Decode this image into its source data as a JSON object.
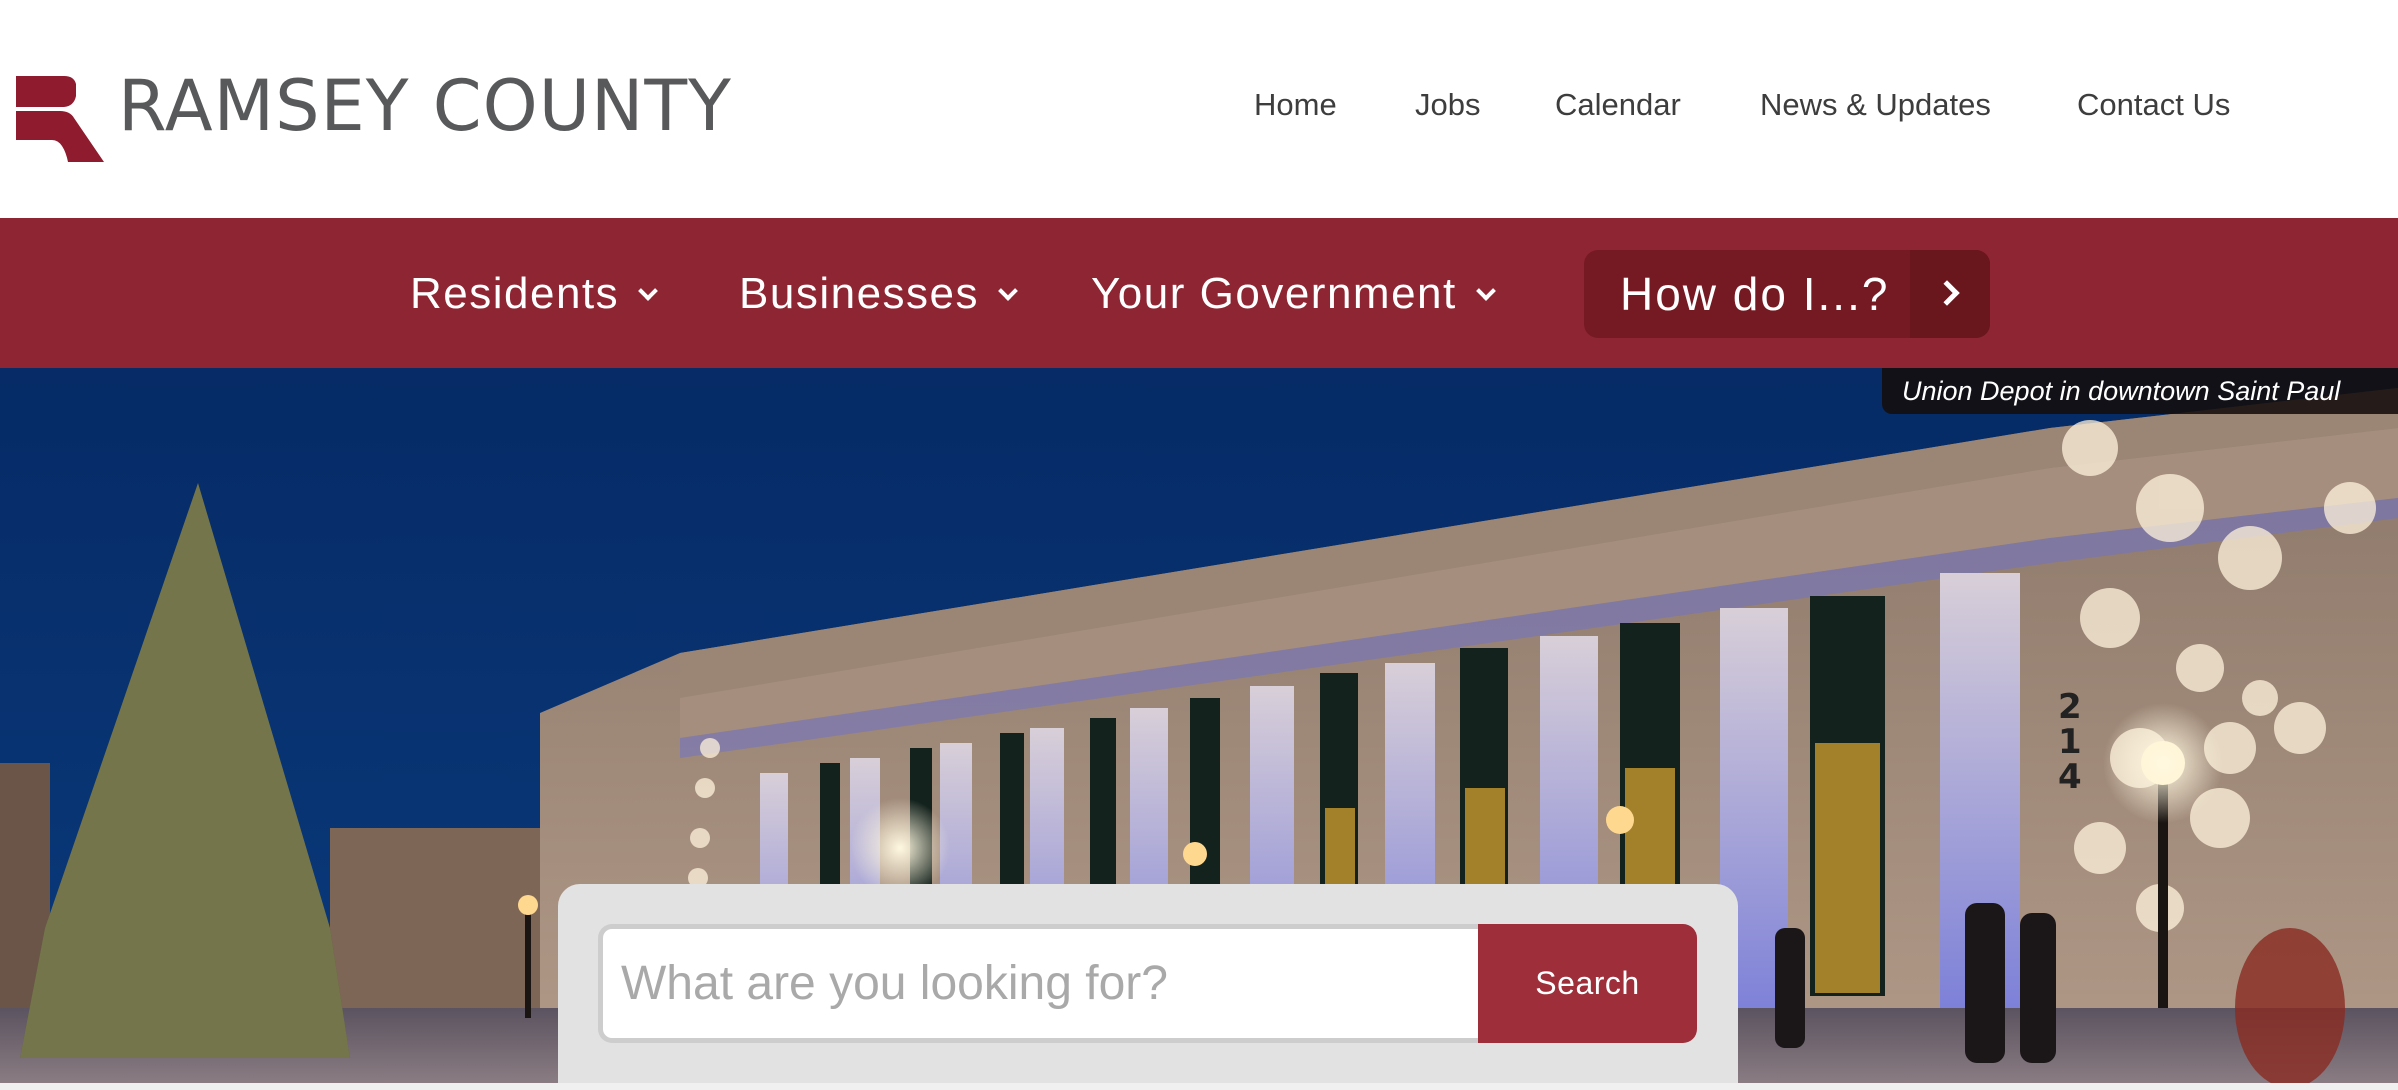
{
  "header": {
    "site_title": "RAMSEY COUNTY",
    "logo_icon": "ramsey-r-logo",
    "brand_color": "#8e2532",
    "utility_nav": [
      {
        "label": "Home"
      },
      {
        "label": "Jobs"
      },
      {
        "label": "Calendar"
      },
      {
        "label": "News & Updates"
      },
      {
        "label": "Contact Us"
      }
    ]
  },
  "main_nav": {
    "items": [
      {
        "label": "Residents",
        "icon": "chevron-down-icon"
      },
      {
        "label": "Businesses",
        "icon": "chevron-down-icon"
      },
      {
        "label": "Your Government",
        "icon": "chevron-down-icon"
      }
    ],
    "how_do_i": {
      "label": "How do I...?",
      "icon": "chevron-right-icon"
    }
  },
  "hero": {
    "image_description": "Union Depot building at night with lit Christmas tree and snowflake projections",
    "caption": "Union Depot in downtown Saint Paul",
    "building_number": "214"
  },
  "search": {
    "placeholder": "What are you looking for?",
    "value": "",
    "button_label": "Search",
    "button_color": "#9e2e3a"
  }
}
